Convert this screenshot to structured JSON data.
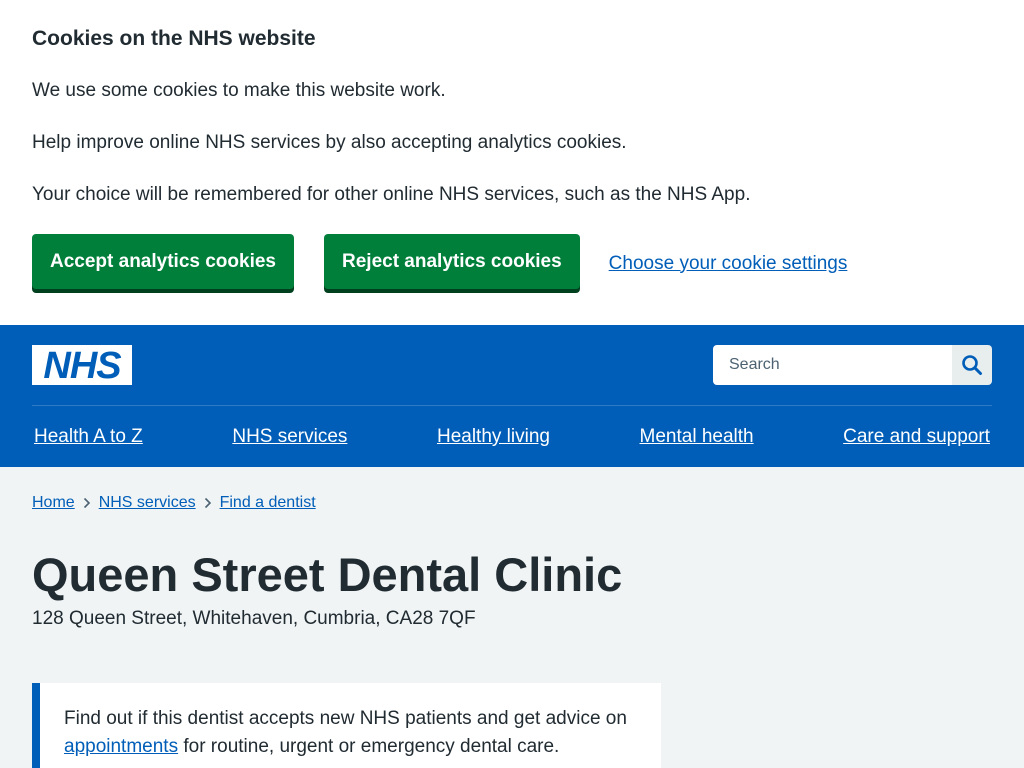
{
  "cookie_banner": {
    "title": "Cookies on the NHS website",
    "paragraphs": [
      "We use some cookies to make this website work.",
      "Help improve online NHS services by also accepting analytics cookies.",
      "Your choice will be remembered for other online NHS services, such as the NHS App."
    ],
    "accept_label": "Accept analytics cookies",
    "reject_label": "Reject analytics cookies",
    "settings_link": "Choose your cookie settings"
  },
  "header": {
    "logo_text": "NHS",
    "search_placeholder": "Search",
    "search_icon": "search-icon",
    "nav": [
      "Health A to Z",
      "NHS services",
      "Healthy living",
      "Mental health",
      "Care and support"
    ]
  },
  "breadcrumb": [
    "Home",
    "NHS services",
    "Find a dentist"
  ],
  "page": {
    "title": "Queen Street Dental Clinic",
    "address": "128 Queen Street, Whitehaven, Cumbria, CA28 7QF",
    "inset_before": "Find out if this dentist accepts new NHS patients and get advice on ",
    "inset_link": "appointments",
    "inset_after": " for routine, urgent or emergency dental care."
  },
  "colors": {
    "nhs_blue": "#005eb8",
    "button_green": "#007f3b",
    "page_background": "#f0f4f5",
    "text": "#212b32"
  }
}
